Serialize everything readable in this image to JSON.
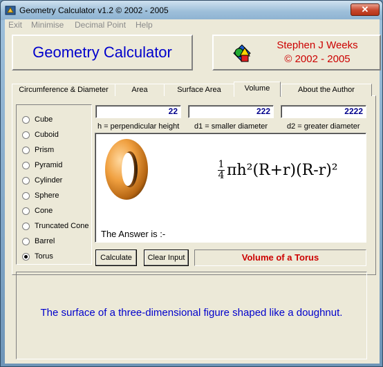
{
  "window": {
    "title": "Geometry Calculator v1.2 ©  2002 - 2005",
    "close_label": "✕"
  },
  "menu": {
    "items": [
      "Exit",
      "Minimise",
      "Decimal Point",
      "Help"
    ]
  },
  "header": {
    "app_title": "Geometry Calculator",
    "author_name": "Stephen J Weeks",
    "author_years": "© 2002 - 2005"
  },
  "tabs": [
    {
      "label": "Circumference & Diameter",
      "active": false
    },
    {
      "label": "Area",
      "active": false
    },
    {
      "label": "Surface Area",
      "active": false
    },
    {
      "label": "Volume",
      "active": true
    },
    {
      "label": "About the Author",
      "active": false
    }
  ],
  "shapes": [
    {
      "label": "Cube",
      "checked": false
    },
    {
      "label": "Cuboid",
      "checked": false
    },
    {
      "label": "Prism",
      "checked": false
    },
    {
      "label": "Pyramid",
      "checked": false
    },
    {
      "label": "Cylinder",
      "checked": false
    },
    {
      "label": "Sphere",
      "checked": false
    },
    {
      "label": "Cone",
      "checked": false
    },
    {
      "label": "Truncated Cone",
      "checked": false
    },
    {
      "label": "Barrel",
      "checked": false
    },
    {
      "label": "Torus",
      "checked": true
    }
  ],
  "inputs": {
    "h_value": "22",
    "d1_value": "222",
    "d2_value": "2222",
    "h_label": "h = perpendicular height",
    "d1_label": "d1 = smaller diameter",
    "d2_label": "d2 = greater diameter"
  },
  "formula": {
    "numerator": "1",
    "denominator": "4",
    "expression": "πh²(R+r)(R-r)²"
  },
  "answer_label": "The Answer is :-",
  "buttons": {
    "calculate": "Calculate",
    "clear_input": "Clear Input"
  },
  "shape_title": "Volume of a Torus",
  "description": "The surface of a three-dimensional figure shaped like a doughnut.",
  "icons": {
    "app": "geometry-app-icon",
    "shapes": "colored-shapes-icon",
    "torus": "torus-image"
  },
  "colors": {
    "title_blue": "#0000cc",
    "author_red": "#cc0000",
    "value_blue": "#00008b",
    "torus_orange": "#f0a040"
  }
}
